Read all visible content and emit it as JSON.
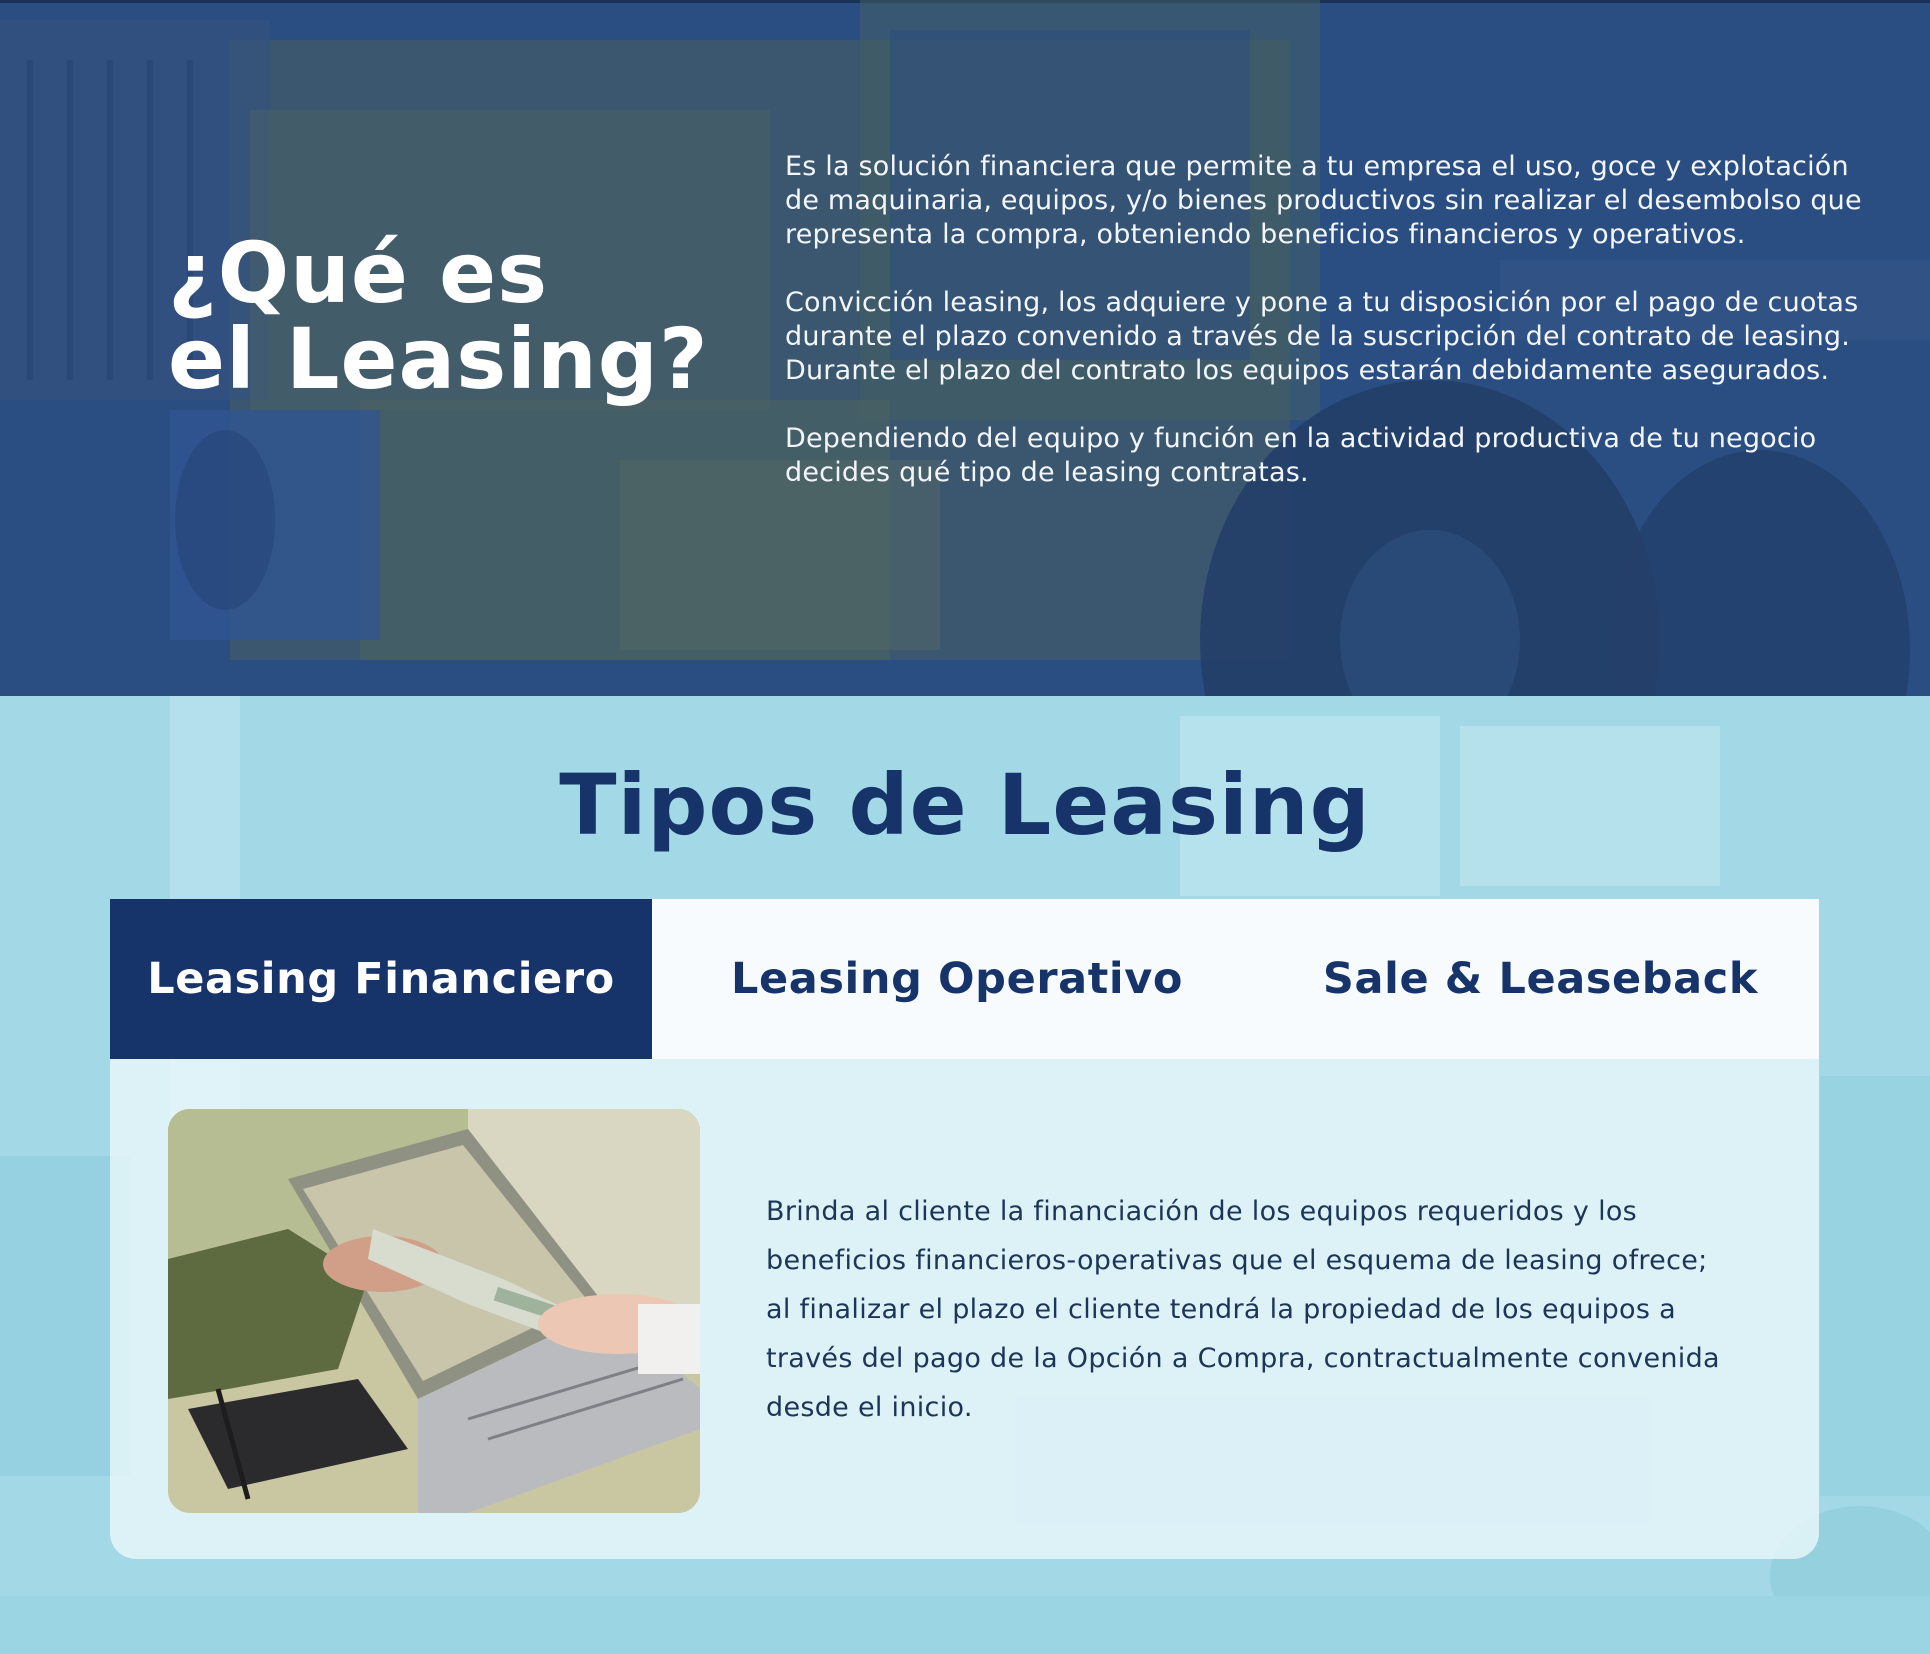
{
  "hero": {
    "title_line1": "¿Qué es",
    "title_line2": "el Leasing?",
    "paragraphs": [
      "Es la solución financiera que permite a tu empresa el uso, goce y explotación de maquinaria, equipos, y/o bienes productivos sin realizar el desembolso que representa la compra, obteniendo beneficios financieros y operativos.",
      "Convicción leasing, los adquiere y pone a tu disposición por el pago de cuotas durante el plazo convenido a través de la suscripción del contrato de leasing. Durante el plazo del contrato los equipos estarán debidamente asegurados.",
      "Dependiendo del equipo y función en la actividad productiva de tu negocio decides qué tipo de leasing contratas."
    ]
  },
  "types": {
    "title": "Tipos de Leasing",
    "tabs": [
      {
        "label": "Leasing Financiero",
        "active": true
      },
      {
        "label": "Leasing Operativo",
        "active": false
      },
      {
        "label": "Sale & Leaseback",
        "active": false
      }
    ],
    "active_description": "Brinda al cliente la financiación de los equipos requeridos y los beneficios financieros-operativas que el esquema de leasing ofrece; al finalizar el plazo el cliente tendrá la propiedad de los equipos a través del pago de la Opción a Compra, contractualmente convenida desde el inicio."
  },
  "colors": {
    "navy": "#17346a",
    "hero_overlay": "#2c4f84",
    "light_cyan": "#9fd8e6",
    "white": "#ffffff"
  }
}
